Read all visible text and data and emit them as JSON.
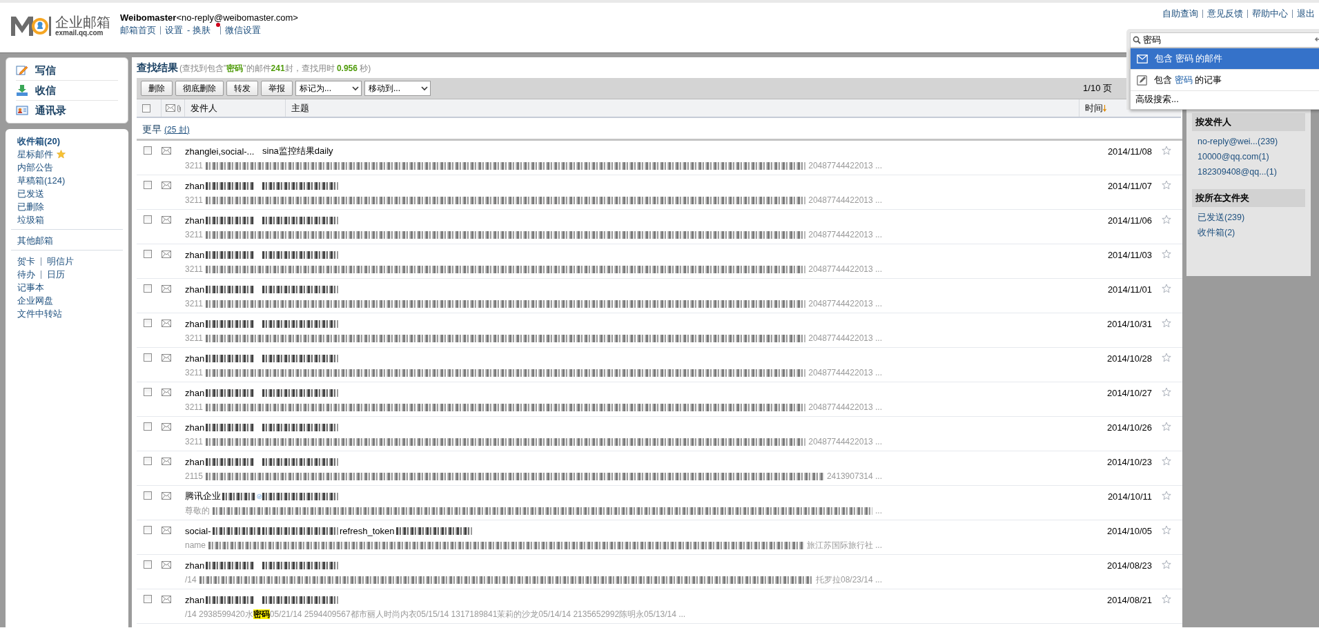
{
  "header": {
    "brand": "企业邮箱",
    "domain": "exmail.qq.com",
    "account_name": "Weibomaster",
    "account_email": "<no-reply@weibomaster.com>",
    "links": [
      {
        "label": "邮箱首页",
        "notify": false
      },
      {
        "label": "设置",
        "notify": false
      },
      {
        "label": "换肤",
        "joiner": "-",
        "notify": true
      },
      {
        "label": "微信设置",
        "notify": false
      }
    ],
    "top_links": [
      "自助查询",
      "意见反馈",
      "帮助中心",
      "退出"
    ]
  },
  "sidebar": {
    "actions": [
      "写信",
      "收信",
      "通讯录"
    ],
    "folders": [
      {
        "label": "收件箱(20)",
        "bold": true,
        "kind": "folder"
      },
      {
        "label": "星标邮件",
        "bold": false,
        "kind": "starred"
      },
      {
        "label": "内部公告",
        "bold": false,
        "kind": "folder"
      },
      {
        "label": "草稿箱(124)",
        "bold": false,
        "kind": "folder"
      },
      {
        "label": "已发送",
        "bold": false,
        "kind": "folder"
      },
      {
        "label": "已删除",
        "bold": false,
        "kind": "folder"
      },
      {
        "label": "垃圾箱",
        "bold": false,
        "kind": "folder"
      }
    ],
    "other": [
      "其他邮箱"
    ],
    "tools": [
      [
        "贺卡",
        "明信片"
      ],
      [
        "待办",
        "日历"
      ],
      [
        "记事本"
      ],
      [
        "企业网盘"
      ],
      [
        "文件中转站"
      ]
    ]
  },
  "results": {
    "title": "查找结果",
    "summary": "(查找到包含\"**密码**\"的邮件**241**封，查找用时 **0.956** 秒)",
    "buttons": [
      "删除",
      "彻底删除",
      "转发",
      "举报"
    ],
    "dropdowns": [
      "标记为...",
      "移动到..."
    ],
    "page": "1/10 页",
    "columns": [
      "发件人",
      "主题",
      "时间"
    ],
    "select_all": {
      "checked": false
    },
    "group": {
      "label": "更早",
      "count": "(25 封)"
    },
    "rows": [
      {
        "sender": [
          {
            "kind": "text",
            "text": "zhanglei,social-..."
          }
        ],
        "subject": [
          {
            "kind": "text",
            "text": "sina监控结果daily"
          }
        ],
        "preview": [
          {
            "kind": "text",
            "text": "3211"
          },
          {
            "kind": "mosaic"
          },
          {
            "kind": "text",
            "text": "20487744422013 ..."
          }
        ],
        "date": "2014/11/08",
        "checked": false
      },
      {
        "sender": [
          {
            "kind": "text",
            "text": "zhan"
          },
          {
            "kind": "mosaic"
          }
        ],
        "subject": [
          {
            "kind": "mosaic"
          }
        ],
        "preview": [
          {
            "kind": "text",
            "text": "3211"
          },
          {
            "kind": "mosaic"
          },
          {
            "kind": "text",
            "text": "20487744422013 ..."
          }
        ],
        "date": "2014/11/07",
        "checked": false
      },
      {
        "sender": [
          {
            "kind": "text",
            "text": "zhan"
          },
          {
            "kind": "mosaic"
          }
        ],
        "subject": [
          {
            "kind": "mosaic"
          }
        ],
        "preview": [
          {
            "kind": "text",
            "text": "3211"
          },
          {
            "kind": "mosaic"
          },
          {
            "kind": "text",
            "text": "20487744422013 ..."
          }
        ],
        "date": "2014/11/06",
        "checked": false
      },
      {
        "sender": [
          {
            "kind": "text",
            "text": "zhan"
          },
          {
            "kind": "mosaic"
          }
        ],
        "subject": [
          {
            "kind": "mosaic"
          }
        ],
        "preview": [
          {
            "kind": "text",
            "text": "3211"
          },
          {
            "kind": "mosaic"
          },
          {
            "kind": "text",
            "text": "20487744422013 ..."
          }
        ],
        "date": "2014/11/03",
        "checked": false
      },
      {
        "sender": [
          {
            "kind": "text",
            "text": "zhan"
          },
          {
            "kind": "mosaic"
          }
        ],
        "subject": [
          {
            "kind": "mosaic"
          }
        ],
        "preview": [
          {
            "kind": "text",
            "text": "3211"
          },
          {
            "kind": "mosaic"
          },
          {
            "kind": "text",
            "text": "20487744422013 ..."
          }
        ],
        "date": "2014/11/01",
        "checked": false
      },
      {
        "sender": [
          {
            "kind": "text",
            "text": "zhan"
          },
          {
            "kind": "mosaic"
          }
        ],
        "subject": [
          {
            "kind": "mosaic"
          }
        ],
        "preview": [
          {
            "kind": "text",
            "text": "3211"
          },
          {
            "kind": "mosaic"
          },
          {
            "kind": "text",
            "text": "20487744422013 ..."
          }
        ],
        "date": "2014/10/31",
        "checked": false
      },
      {
        "sender": [
          {
            "kind": "text",
            "text": "zhan"
          },
          {
            "kind": "mosaic"
          }
        ],
        "subject": [
          {
            "kind": "mosaic"
          }
        ],
        "preview": [
          {
            "kind": "text",
            "text": "3211"
          },
          {
            "kind": "mosaic"
          },
          {
            "kind": "text",
            "text": "20487744422013 ..."
          }
        ],
        "date": "2014/10/28",
        "checked": false
      },
      {
        "sender": [
          {
            "kind": "text",
            "text": "zhan"
          },
          {
            "kind": "mosaic"
          }
        ],
        "subject": [
          {
            "kind": "mosaic"
          }
        ],
        "preview": [
          {
            "kind": "text",
            "text": "3211"
          },
          {
            "kind": "mosaic"
          },
          {
            "kind": "text",
            "text": "20487744422013 ..."
          }
        ],
        "date": "2014/10/27",
        "checked": false
      },
      {
        "sender": [
          {
            "kind": "text",
            "text": "zhan"
          },
          {
            "kind": "mosaic"
          }
        ],
        "subject": [
          {
            "kind": "mosaic"
          }
        ],
        "preview": [
          {
            "kind": "text",
            "text": "3211"
          },
          {
            "kind": "mosaic"
          },
          {
            "kind": "text",
            "text": "20487744422013 ..."
          }
        ],
        "date": "2014/10/26",
        "checked": false
      },
      {
        "sender": [
          {
            "kind": "text",
            "text": "zhan"
          },
          {
            "kind": "mosaic"
          }
        ],
        "subject": [
          {
            "kind": "mosaic"
          }
        ],
        "preview": [
          {
            "kind": "text",
            "text": "2115"
          },
          {
            "kind": "mosaic"
          },
          {
            "kind": "text",
            "text": "2413907314 ..."
          }
        ],
        "date": "2014/10/23",
        "checked": false
      },
      {
        "sender": [
          {
            "kind": "text",
            "text": "腾讯企业"
          },
          {
            "kind": "mosaic"
          },
          {
            "kind": "verified"
          }
        ],
        "subject": [
          {
            "kind": "mosaic"
          }
        ],
        "preview": [
          {
            "kind": "text",
            "text": "尊敬的"
          },
          {
            "kind": "mosaic"
          },
          {
            "kind": "text",
            "text": "..."
          }
        ],
        "date": "2014/10/11",
        "checked": false
      },
      {
        "sender": [
          {
            "kind": "text",
            "text": "social-"
          },
          {
            "kind": "mosaic"
          }
        ],
        "subject": [
          {
            "kind": "mosaic"
          },
          {
            "kind": "text",
            "text": "refresh_token"
          },
          {
            "kind": "mosaic"
          }
        ],
        "preview": [
          {
            "kind": "text",
            "text": "name"
          },
          {
            "kind": "mosaic"
          },
          {
            "kind": "text",
            "text": "旅江苏国际旅行社 ..."
          }
        ],
        "date": "2014/10/05",
        "checked": false
      },
      {
        "sender": [
          {
            "kind": "text",
            "text": "zhan"
          },
          {
            "kind": "mosaic"
          }
        ],
        "subject": [
          {
            "kind": "mosaic"
          }
        ],
        "preview": [
          {
            "kind": "text",
            "text": "/14"
          },
          {
            "kind": "mosaic"
          },
          {
            "kind": "text",
            "text": "托罗拉08/23/14 ..."
          }
        ],
        "date": "2014/08/23",
        "checked": false
      },
      {
        "sender": [
          {
            "kind": "text",
            "text": "zhan"
          },
          {
            "kind": "mosaic"
          }
        ],
        "subject": [
          {
            "kind": "mosaic"
          }
        ],
        "preview": [
          {
            "kind": "text",
            "text": "/14 2938599420水**密码**05/21/14 2594409567都市丽人时尚内衣05/15/14 1317189841茉莉的沙龙05/14/14 2135652992陈明永05/13/14 ..."
          }
        ],
        "date": "2014/08/21",
        "checked": false
      }
    ]
  },
  "filters": [
    {
      "title": "按发件人",
      "items": [
        "no-reply@wei...(239)",
        "10000@qq.com(1)",
        "182309408@qq...(1)"
      ]
    },
    {
      "title": "按所在文件夹",
      "items": [
        "已发送(239)",
        "收件箱(2)"
      ]
    }
  ],
  "search": {
    "value": "密码",
    "suggestions": [
      {
        "kind": "mail",
        "label": "包含 *密码* 的邮件",
        "selected": true
      },
      {
        "kind": "note",
        "label": "包含 *密码* 的记事",
        "selected": false
      }
    ],
    "advanced": "高级搜索..."
  }
}
